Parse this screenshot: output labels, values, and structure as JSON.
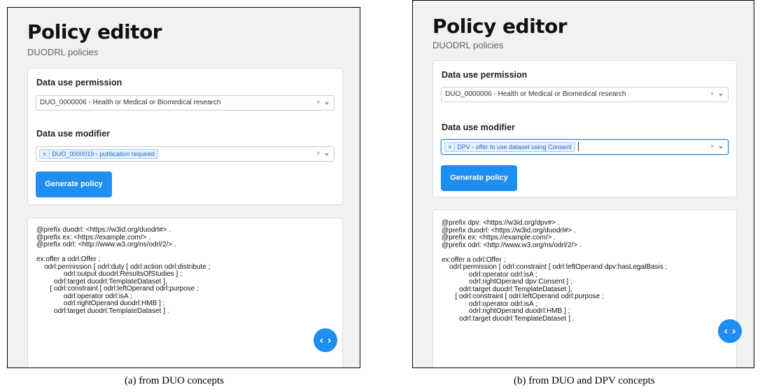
{
  "panel_a": {
    "title": "Policy editor",
    "subtitle": "DUODRL policies",
    "permission_label": "Data use permission",
    "permission_value": "DUO_0000006 - Health or Medical or Biomedical research",
    "modifier_label": "Data use modifier",
    "modifier_tag": "DUO_0000019 - publication required",
    "button_label": "Generate policy",
    "code": "@prefix duodrl: <https://w3id.org/duodrl#> .\n@prefix ex: <https://example.com/> .\n@prefix odrl: <http://www.w3.org/ns/odrl/2/> .\n\nex:offer a odrl:Offer ;\n    odrl:permission [ odrl:duty [ odrl:action odrl:distribute ;\n              odrl:output duodrl:ResultsOfStudies ] ;\n         odrl:target duodrl:TemplateDataset ],\n       [ odrl:constraint [ odrl:leftOperand odrl:purpose ;\n              odrl:operator odrl:isA ;\n              odrl:rightOperand duodrl:HMB ] ;\n         odrl:target duodrl:TemplateDataset ] .",
    "fab_icon": "code-brackets-icon",
    "caption": "(a)  from DUO concepts"
  },
  "panel_b": {
    "title": "Policy editor",
    "subtitle": "DUODRL policies",
    "permission_label": "Data use permission",
    "permission_value": "DUO_0000006 - Health or Medical or Biomedical research",
    "modifier_label": "Data use modifier",
    "modifier_tag": "DPV - offer to use dataset using Consent",
    "button_label": "Generate policy",
    "code": "@prefix dpv: <https://w3id.org/dpv#> .\n@prefix duodrl: <https://w3id.org/duodrl#> .\n@prefix ex: <https://example.com/> .\n@prefix odrl: <http://www.w3.org/ns/odrl/2/> .\n\nex:offer a odrl:Offer ;\n    odrl:permission [ odrl:constraint [ odrl:leftOperand dpv:hasLegalBasis ;\n              odrl:operator odrl:isA ;\n              odrl:rightOperand dpv:Consent ] ;\n         odrl:target duodrl:TemplateDataset ],\n       [ odrl:constraint [ odrl:leftOperand odrl:purpose ;\n              odrl:operator odrl:isA ;\n              odrl:rightOperand duodrl:HMB ] ;\n         odrl:target duodrl:TemplateDataset ] .",
    "fab_icon": "code-brackets-icon",
    "caption": "(b)  from DUO and DPV concepts"
  },
  "icons": {
    "clear": "×",
    "tag_remove": "×",
    "fab": "‹ ›"
  },
  "colors": {
    "accent": "#1e8ef2",
    "background": "#f1f1f1",
    "card": "#ffffff"
  }
}
